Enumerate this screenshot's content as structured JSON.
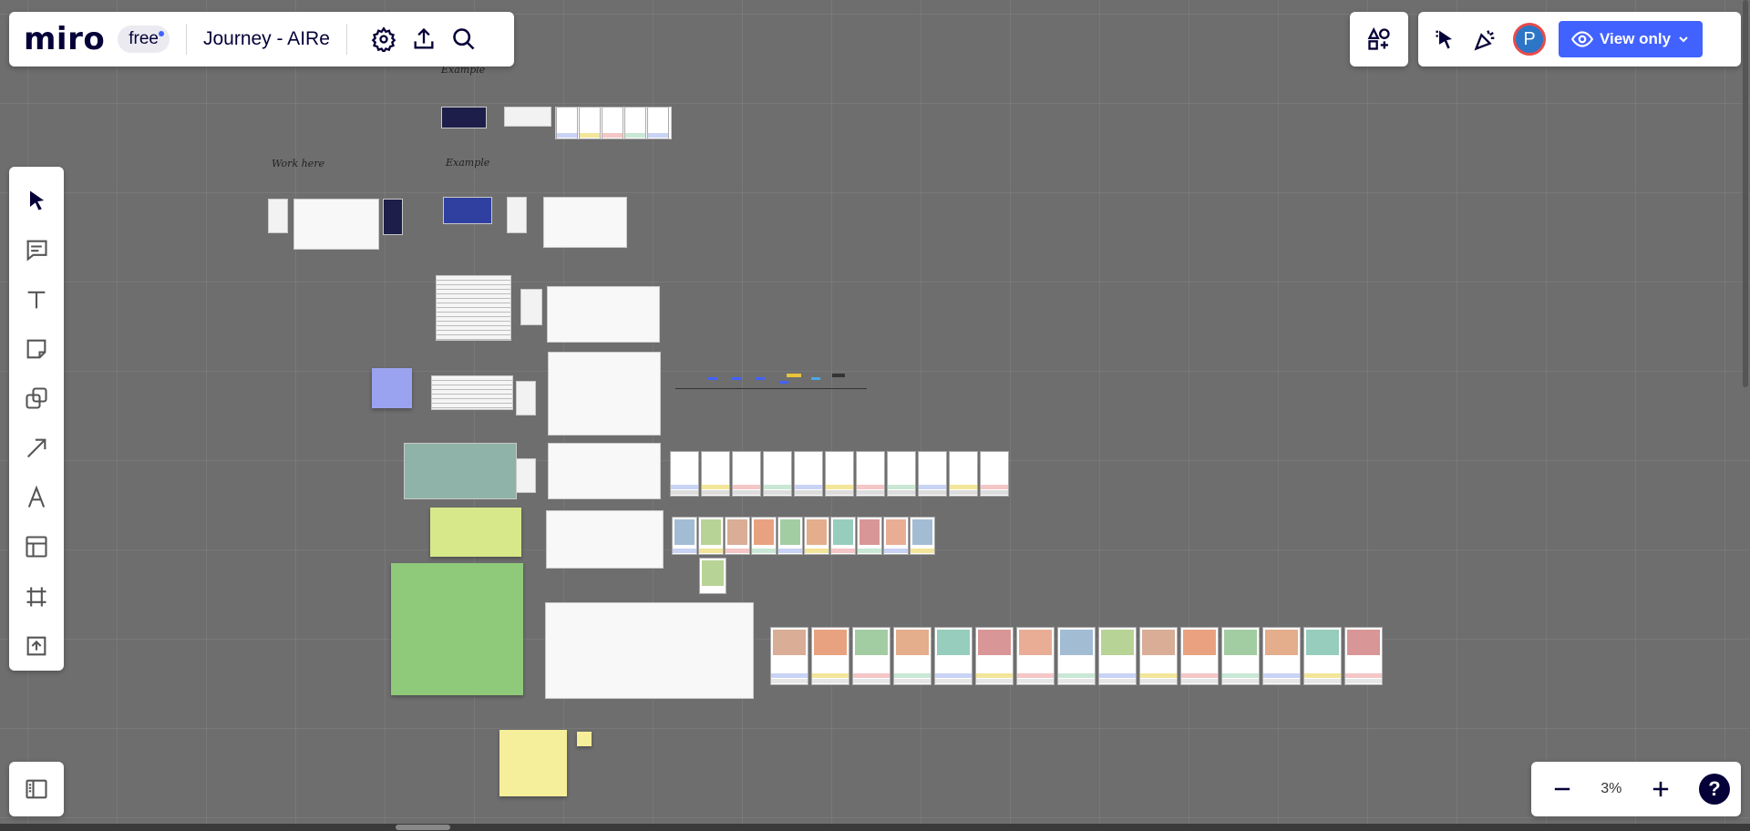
{
  "app": {
    "logo": "miro",
    "plan_badge": "free",
    "board_title": "Journey - AIRe"
  },
  "header": {
    "settings": "gear-icon",
    "share": "upload-icon",
    "search": "search-icon"
  },
  "collab": {
    "avatar_initial": "P",
    "view_label": "View only"
  },
  "toolbar": {
    "items": [
      "select",
      "comment",
      "text",
      "sticky-note",
      "shapes",
      "connection-line",
      "pen",
      "templates",
      "frame",
      "upload"
    ]
  },
  "zoom": {
    "value": "3%",
    "help": "?"
  },
  "board": {
    "labels": {
      "example_top": "Example",
      "work_here": "Work here",
      "example_mid": "Example"
    }
  },
  "colors": {
    "accent": "#4262ff",
    "canvas": "#6e6e6e",
    "logo": "#050038"
  }
}
